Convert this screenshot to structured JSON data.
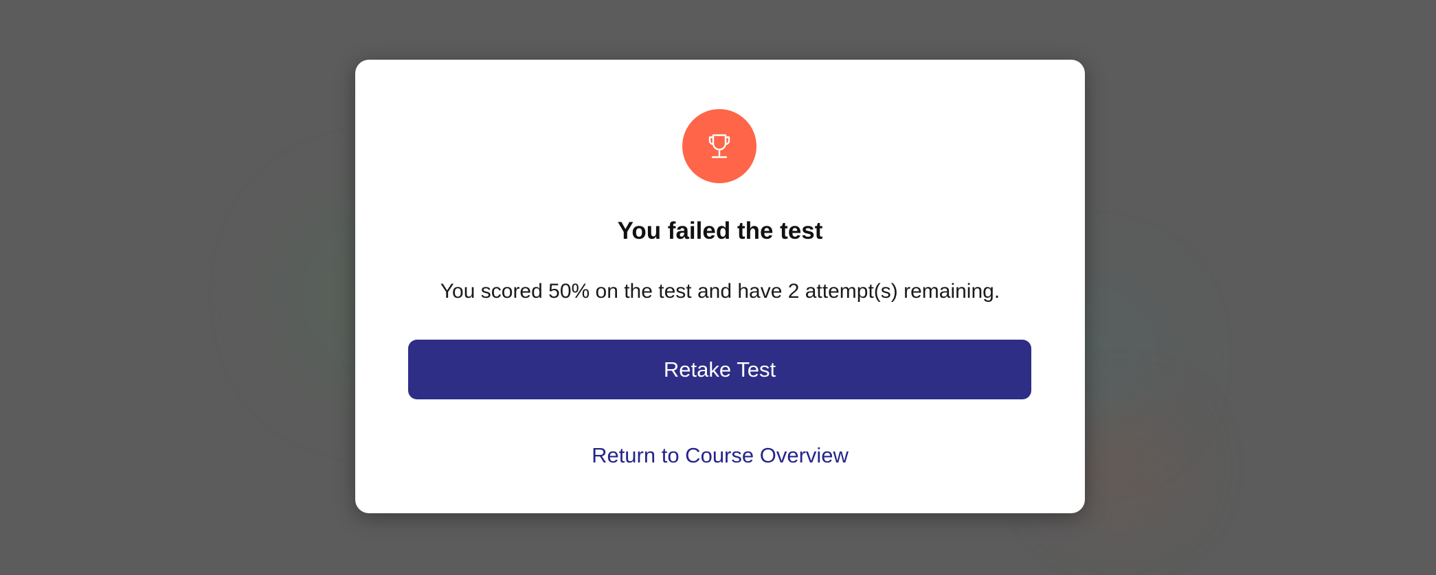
{
  "modal": {
    "icon": "trophy-icon",
    "icon_bg_color": "#fe6549",
    "title": "You failed the test",
    "message": "You scored 50% on the test and have 2 attempt(s) remaining.",
    "primary_button_label": "Retake Test",
    "primary_button_color": "#2e2e86",
    "secondary_link_label": "Return to Course Overview",
    "secondary_link_color": "#25258a"
  }
}
